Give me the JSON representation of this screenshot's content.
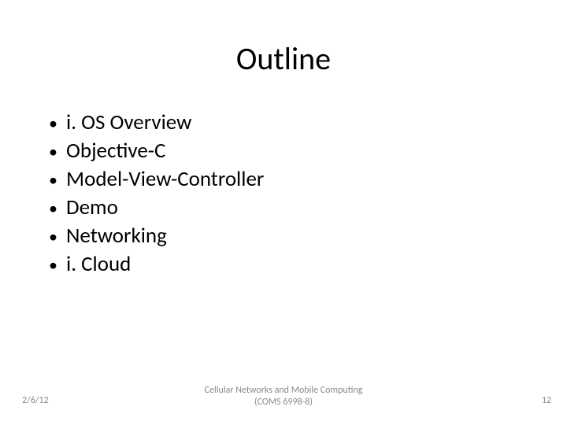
{
  "title": "Outline",
  "bullets": [
    "i. OS Overview",
    "Objective-C",
    "Model-View-Controller",
    "Demo",
    "Networking",
    "i. Cloud"
  ],
  "footer": {
    "date": "2/6/12",
    "center_line1": "Cellular Networks and Mobile Computing",
    "center_line2": "(COMS 6998-8)",
    "page": "12"
  }
}
